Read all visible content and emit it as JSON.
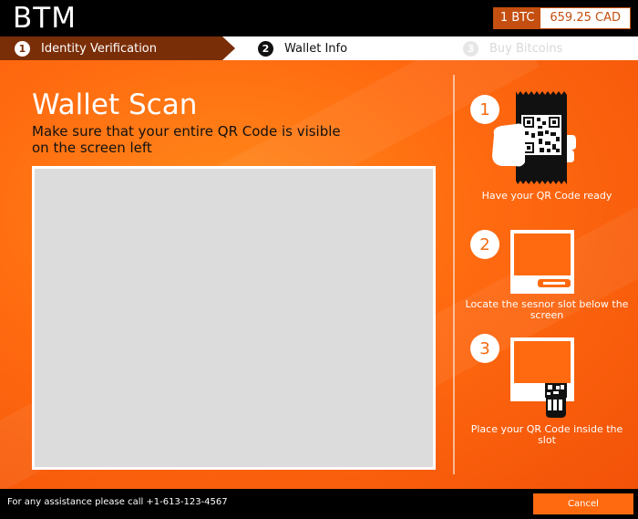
{
  "header": {
    "logo": "BTM",
    "price_unit": "1 BTC",
    "price_value": "659.25 CAD"
  },
  "steps": [
    {
      "num": "1",
      "label": "Identity Verification",
      "state": "done"
    },
    {
      "num": "2",
      "label": "Wallet Info",
      "state": "current"
    },
    {
      "num": "3",
      "label": "Buy Bitcoins",
      "state": "upcoming"
    }
  ],
  "main": {
    "title": "Wallet Scan",
    "subtitle": "Make sure that your entire QR Code is visible on the screen left"
  },
  "instructions": [
    {
      "num": "1",
      "text": "Have your QR Code ready"
    },
    {
      "num": "2",
      "text": "Locate the sesnor slot below the screen"
    },
    {
      "num": "3",
      "text": "Place your QR Code inside the slot"
    }
  ],
  "footer": {
    "assist": "For any assistance please call +1-613-123-4567",
    "cancel_label": "Cancel"
  },
  "colors": {
    "brand_orange": "#ff6a10",
    "brand_dark": "#7a2e08",
    "price_accent": "#c44f10"
  }
}
